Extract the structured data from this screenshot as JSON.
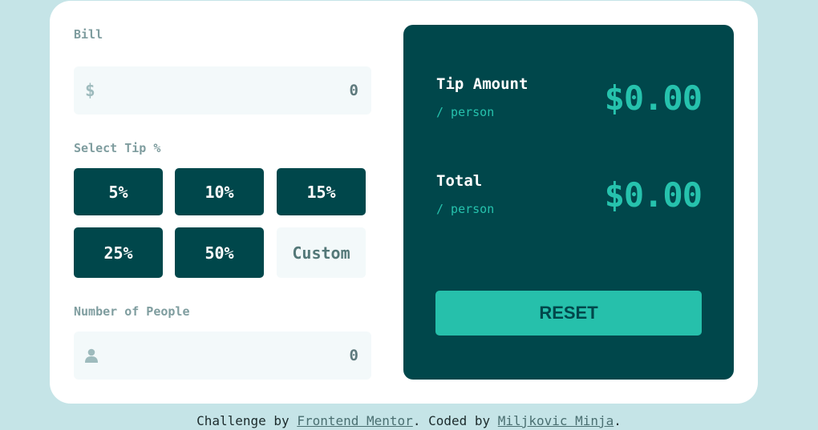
{
  "bill": {
    "label": "Bill",
    "currency_symbol": "$",
    "placeholder": "0"
  },
  "tip": {
    "label": "Select Tip %",
    "options": [
      "5%",
      "10%",
      "15%",
      "25%",
      "50%"
    ],
    "custom_placeholder": "Custom"
  },
  "people": {
    "label": "Number of People",
    "icon": "person-icon",
    "placeholder": "0"
  },
  "results": {
    "tip_amount": {
      "title": "Tip Amount",
      "subtitle": "/ person",
      "value": "$0.00"
    },
    "total": {
      "title": "Total",
      "subtitle": "/ person",
      "value": "$0.00"
    },
    "reset_label": "RESET"
  },
  "footer": {
    "prefix": "Challenge by ",
    "link1": "Frontend Mentor",
    "middle": ". Coded by ",
    "link2": "Miljkovic Minja",
    "suffix": "."
  },
  "colors": {
    "background": "#c5e4e7",
    "card": "#ffffff",
    "dark_green": "#00474b",
    "accent": "#26c2ad",
    "input_bg": "#f3f9fa",
    "label": "#7f9d9f"
  }
}
